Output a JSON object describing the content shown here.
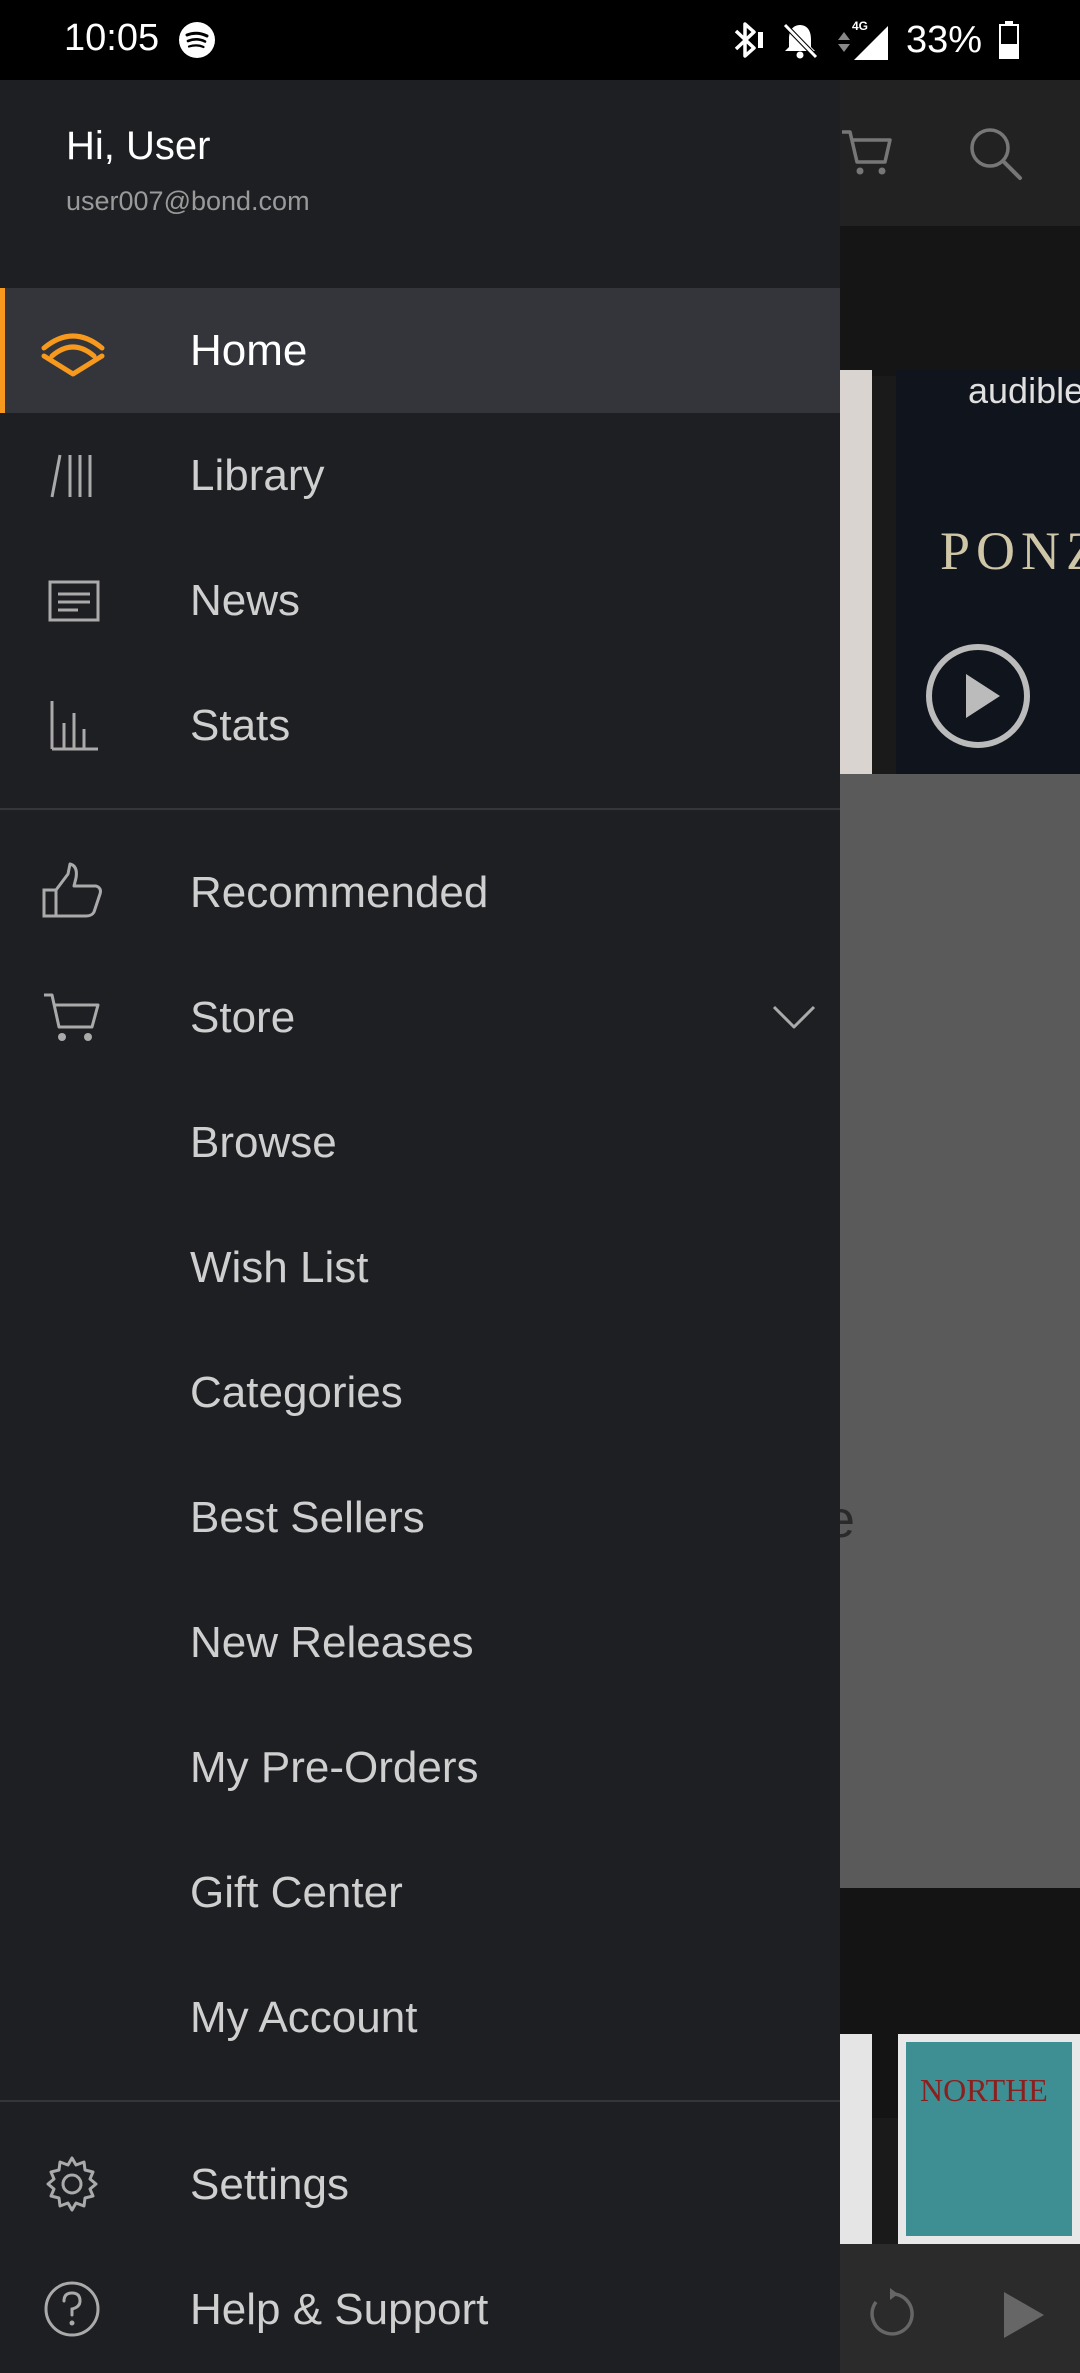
{
  "status_bar": {
    "time": "10:05",
    "battery_percent": "33%",
    "network": "4G",
    "icons": [
      "spotify-icon",
      "bluetooth-icon",
      "bell-off-icon",
      "signal-icon",
      "battery-icon"
    ]
  },
  "background": {
    "brand": "audible",
    "book_title": "PONZI",
    "partial_text": "e",
    "book2_title": "NORTHE",
    "icons": [
      "cart-icon",
      "search-icon",
      "play-circle-icon",
      "rewind-icon",
      "play-icon"
    ]
  },
  "drawer": {
    "greeting": "Hi, User",
    "email": "user007@bond.com",
    "primary_items": [
      {
        "label": "Home",
        "icon": "audible-home-icon",
        "active": true
      },
      {
        "label": "Library",
        "icon": "library-icon"
      },
      {
        "label": "News",
        "icon": "news-icon"
      },
      {
        "label": "Stats",
        "icon": "stats-icon"
      }
    ],
    "store_items": [
      {
        "label": "Recommended",
        "icon": "thumbs-up-icon"
      },
      {
        "label": "Store",
        "icon": "cart-icon",
        "expanded": true
      },
      {
        "label": "Browse"
      },
      {
        "label": "Wish List"
      },
      {
        "label": "Categories"
      },
      {
        "label": "Best Sellers"
      },
      {
        "label": "New Releases"
      },
      {
        "label": "My Pre-Orders"
      },
      {
        "label": "Gift Center"
      },
      {
        "label": "My Account"
      }
    ],
    "footer_items": [
      {
        "label": "Settings",
        "icon": "gear-icon"
      },
      {
        "label": "Help & Support",
        "icon": "help-icon"
      }
    ]
  },
  "colors": {
    "accent": "#f7991c",
    "drawer_bg": "#1e1f22",
    "active_bg": "#33353a"
  }
}
